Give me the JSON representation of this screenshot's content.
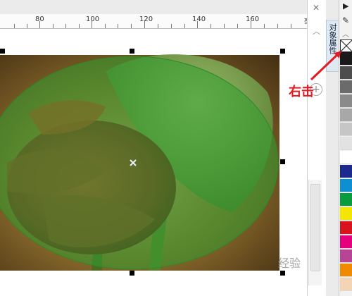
{
  "ruler": {
    "labels": [
      "80",
      "100",
      "120",
      "140",
      "160"
    ],
    "unit": "毫米"
  },
  "docker": {
    "tab_label": "对象属性"
  },
  "palette": {
    "no_color_swatch": "no-fill",
    "colors": [
      "#1a1a1a",
      "#4d4d4d",
      "#6b6b6b",
      "#8a8a8a",
      "#a8a8a8",
      "#c6c6c6",
      "#e2e2e2",
      "#ffffff",
      "#1b2a8c",
      "#0e8fd1",
      "#089c3f",
      "#f3e600",
      "#d9141d",
      "#e5007e",
      "#b64595",
      "#f08a00",
      "#f3d5b5"
    ]
  },
  "annotation": {
    "text": "右击"
  },
  "watermark": {
    "text": "经验"
  }
}
